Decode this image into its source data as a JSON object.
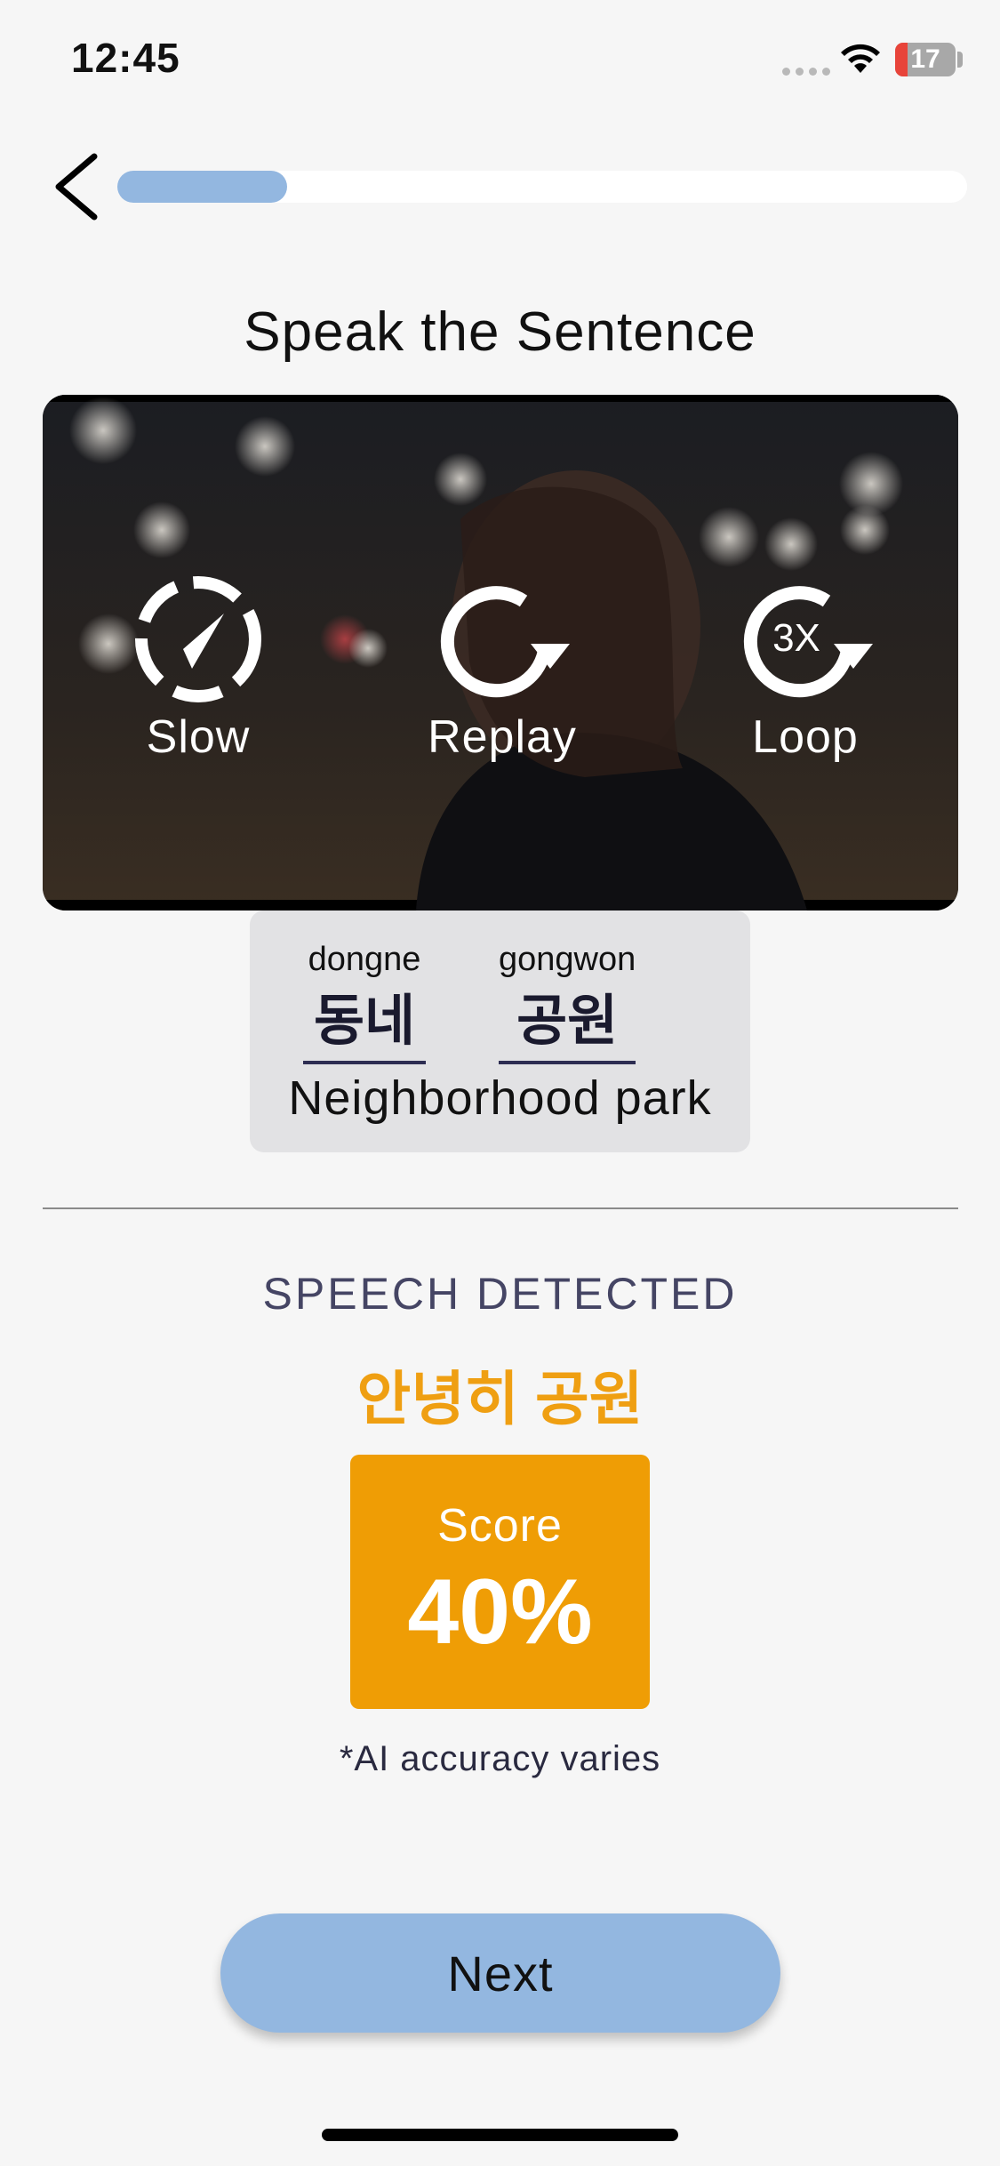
{
  "status_bar": {
    "time": "12:45",
    "battery": "17",
    "wifi_icon": "wifi-icon"
  },
  "header": {
    "back_icon": "chevron-left-icon",
    "progress": 0.15
  },
  "title": "Speak the Sentence",
  "video": {
    "controls": [
      {
        "label": "Slow",
        "icon": "slow-speed-icon"
      },
      {
        "label": "Replay",
        "icon": "replay-icon"
      },
      {
        "label": "Loop",
        "icon": "loop-3x-icon",
        "icon_text": "3X"
      }
    ]
  },
  "word_card": {
    "words": [
      {
        "romanization": "dongne",
        "korean": "동네"
      },
      {
        "romanization": "gongwon",
        "korean": "공원"
      }
    ],
    "translation": "Neighborhood park"
  },
  "speech": {
    "label": "SPEECH DETECTED",
    "detected_text": "안녕히 공원"
  },
  "score": {
    "label": "Score",
    "value": "40%"
  },
  "disclaimer": "*AI accuracy varies",
  "next_button": "Next",
  "colors": {
    "accent_blue": "#93b7e0",
    "score_orange": "#ef9d05",
    "detected_orange": "#ef9f12"
  }
}
